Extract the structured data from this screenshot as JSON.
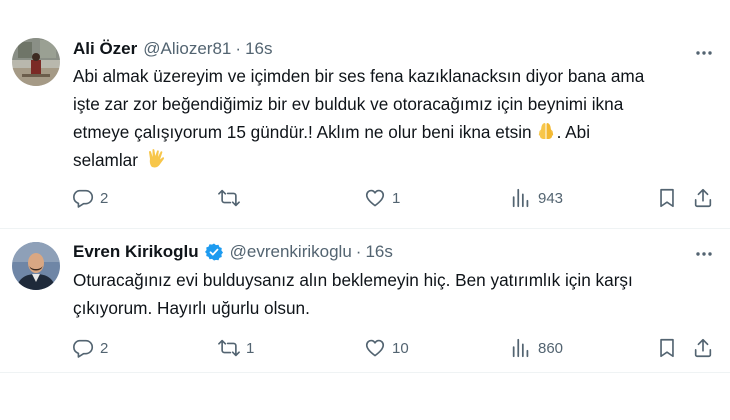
{
  "tweets": [
    {
      "author": {
        "name": "Ali Özer",
        "handle": "@Aliozer81",
        "verified": false
      },
      "separator": "·",
      "time": "16s",
      "text_lines": [
        "Abi almak üzereyim ve içimden bir ses fena kazıklanacksın diyor bana ama",
        "işte zar zor beğendiğimiz bir ev bulduk ve otoracağımız için beynimi ikna",
        "etmeye çalışıyorum 15 gündür.! Aklım ne olur beni ikna etsin",
        "selamlar"
      ],
      "text_after_emoji": ". Abi",
      "emojis": [
        "praying-hands-emoji",
        "vulcan-salute-emoji"
      ],
      "stats": {
        "replies": "2",
        "retweets": "",
        "likes": "1",
        "views": "943"
      }
    },
    {
      "author": {
        "name": "Evren Kirikoglu",
        "handle": "@evrenkirikoglu",
        "verified": true
      },
      "separator": "·",
      "time": "16s",
      "text_lines": [
        "Oturacağınız evi bulduysanız alın beklemeyin hiç. Ben yatırımlık için karşı",
        "çıkıyorum. Hayırlı uğurlu olsun."
      ],
      "stats": {
        "replies": "2",
        "retweets": "1",
        "likes": "10",
        "views": "860"
      }
    }
  ],
  "icons": [
    "more-icon",
    "reply-icon",
    "retweet-icon",
    "like-icon",
    "views-icon",
    "bookmark-icon",
    "share-icon",
    "verified-badge-icon"
  ],
  "colors": {
    "text": "#0f1419",
    "secondary": "#536471",
    "divider": "#eff3f4",
    "verified": "#1d9bf0",
    "background": "#ffffff"
  }
}
